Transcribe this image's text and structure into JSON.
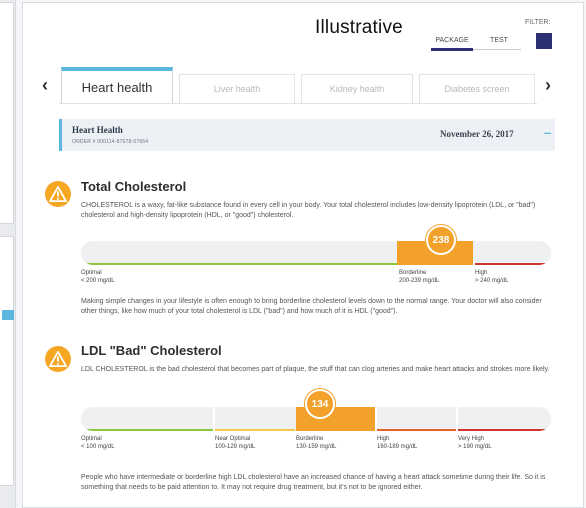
{
  "header": {
    "watermark": "Illustrative",
    "filter_label": "FILTER:",
    "view_toggle": [
      "PACKAGE",
      "TEST"
    ],
    "view_selected": "PACKAGE"
  },
  "tabs": [
    {
      "label": "Heart health",
      "active": true
    },
    {
      "label": "Liver health",
      "active": false
    },
    {
      "label": "Kidney health",
      "active": false
    },
    {
      "label": "Diabetes screen",
      "active": false
    }
  ],
  "nav": {
    "prev": "‹",
    "next": "›"
  },
  "order": {
    "title": "Heart Health",
    "number": "ORDER # 000114-87678-07664",
    "date": "November 26, 2017",
    "toggle": "–"
  },
  "tests": [
    {
      "title": "Total Cholesterol",
      "description": "CHOLESTEROL is a waxy, fat-like substance found in every cell in your body. Your total cholesterol includes low-density lipoprotein (LDL, or \"bad\") cholesterol and high-density lipoprotein (HDL, or \"good\") cholesterol.",
      "value": "238",
      "ranges": [
        {
          "name": "Optimal",
          "range": "< 200 mg/dL",
          "color": "#8cc63f"
        },
        {
          "name": "Borderline",
          "range": "200-239 mg/dL",
          "color": "#f2a12a"
        },
        {
          "name": "High",
          "range": "> 240 mg/dL",
          "color": "#d0342c"
        }
      ],
      "highlighted_range": "Borderline",
      "note": "Making simple changes in your lifestyle is often enough to bring borderline cholesterol levels down to the normal range. Your doctor will also consider other things, like how much of your total cholesterol is LDL (\"bad\") and how much of it is HDL (\"good\")."
    },
    {
      "title": "LDL \"Bad\" Cholesterol",
      "description": "LDL CHOLESTEROL is the bad cholesterol that becomes part of plaque, the stuff that can clog arteries and make heart attacks and strokes more likely.",
      "value": "134",
      "ranges": [
        {
          "name": "Optimal",
          "range": "< 100 mg/dL",
          "color": "#8cc63f"
        },
        {
          "name": "Near Optimal",
          "range": "100-129 mg/dL",
          "color": "#f2c94c"
        },
        {
          "name": "Borderline",
          "range": "130-159 mg/dL",
          "color": "#f2a12a"
        },
        {
          "name": "High",
          "range": "160-189 mg/dL",
          "color": "#e2622b"
        },
        {
          "name": "Very High",
          "range": "> 190 mg/dL",
          "color": "#d0342c"
        }
      ],
      "highlighted_range": "Borderline",
      "note": "People who have intermediate or borderline high LDL cholesterol have an increased chance of having a heart attack sometime during their life. So it is something that needs to be paid attention to. It may not require drug treatment, but it's not to be ignored either."
    }
  ],
  "colors": {
    "accent": "#5bb7dd",
    "brand": "#2c3176",
    "warning": "#f5a623"
  }
}
